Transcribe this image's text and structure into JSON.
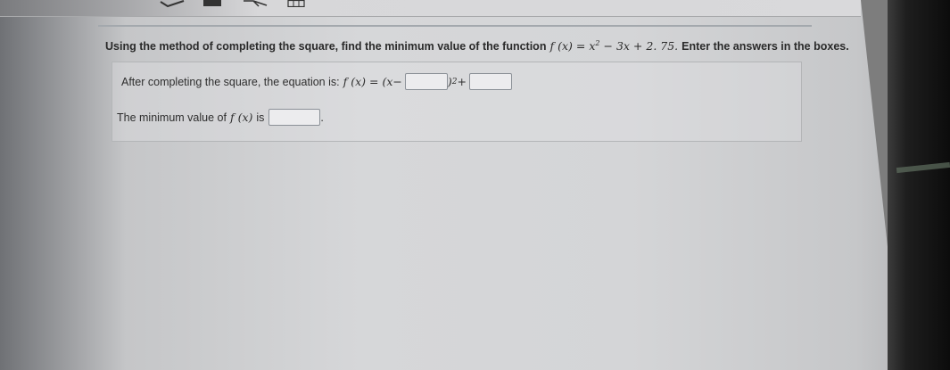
{
  "question": {
    "lead_text": "Using the method of completing the square, find the minimum value of the function",
    "function_name": "f",
    "function_var": "(x)",
    "function_equals": "=",
    "function_body_base": "x",
    "function_body_exp": "2",
    "function_body_rest": "− 3x + 2. 75.",
    "instruction": "Enter the answers in the boxes."
  },
  "completed_square": {
    "label": "After completing the square, the equation is:",
    "lhs": "f (x) =",
    "open_part": "(x−",
    "close_part": ")",
    "exponent": "2",
    "plus": "+",
    "box_h_value": "",
    "box_k_value": ""
  },
  "minimum": {
    "label": "The minimum value of",
    "fx": "f (x)",
    "is_word": "is",
    "box_min_value": "",
    "period": "."
  }
}
